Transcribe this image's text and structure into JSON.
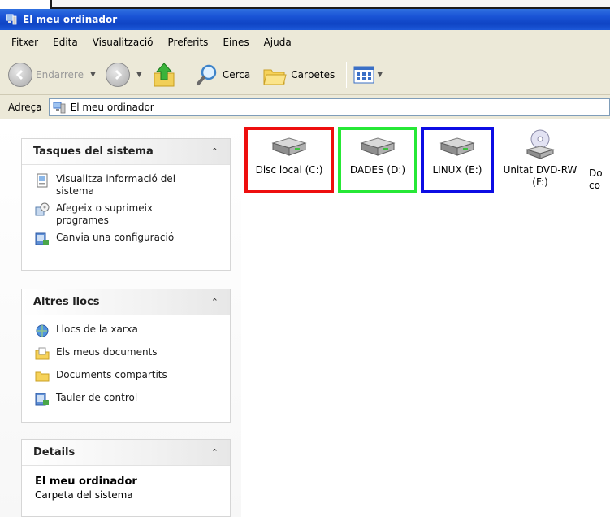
{
  "window": {
    "title": "El meu ordinador"
  },
  "menu": {
    "items": [
      "Fitxer",
      "Edita",
      "Visualització",
      "Preferits",
      "Eines",
      "Ajuda"
    ]
  },
  "toolbar": {
    "back_label": "Endarrere",
    "search_label": "Cerca",
    "folders_label": "Carpetes"
  },
  "address": {
    "label": "Adreça",
    "value": "El meu ordinador"
  },
  "sidebar": {
    "system_tasks": {
      "title": "Tasques del sistema",
      "items": [
        "Visualitza informació del sistema",
        "Afegeix o suprimeix programes",
        "Canvia una configuració"
      ]
    },
    "other_places": {
      "title": "Altres llocs",
      "items": [
        "Llocs de la xarxa",
        "Els meus documents",
        "Documents compartits",
        "Tauler de control"
      ]
    },
    "details": {
      "title": "Details",
      "name": "El meu ordinador",
      "subtitle": "Carpeta del sistema"
    }
  },
  "drives": [
    {
      "label": "Disc local (C:)",
      "highlight": "#ee0e0e"
    },
    {
      "label": "DADES (D:)",
      "highlight": "#26e836"
    },
    {
      "label": "LINUX (E:)",
      "highlight": "#0d0de4"
    },
    {
      "label": "Unitat DVD-RW (F:)"
    },
    {
      "label": "Do co"
    }
  ],
  "colors": {
    "titlebar": "#1a54d6",
    "chrome": "#ece9d8"
  }
}
